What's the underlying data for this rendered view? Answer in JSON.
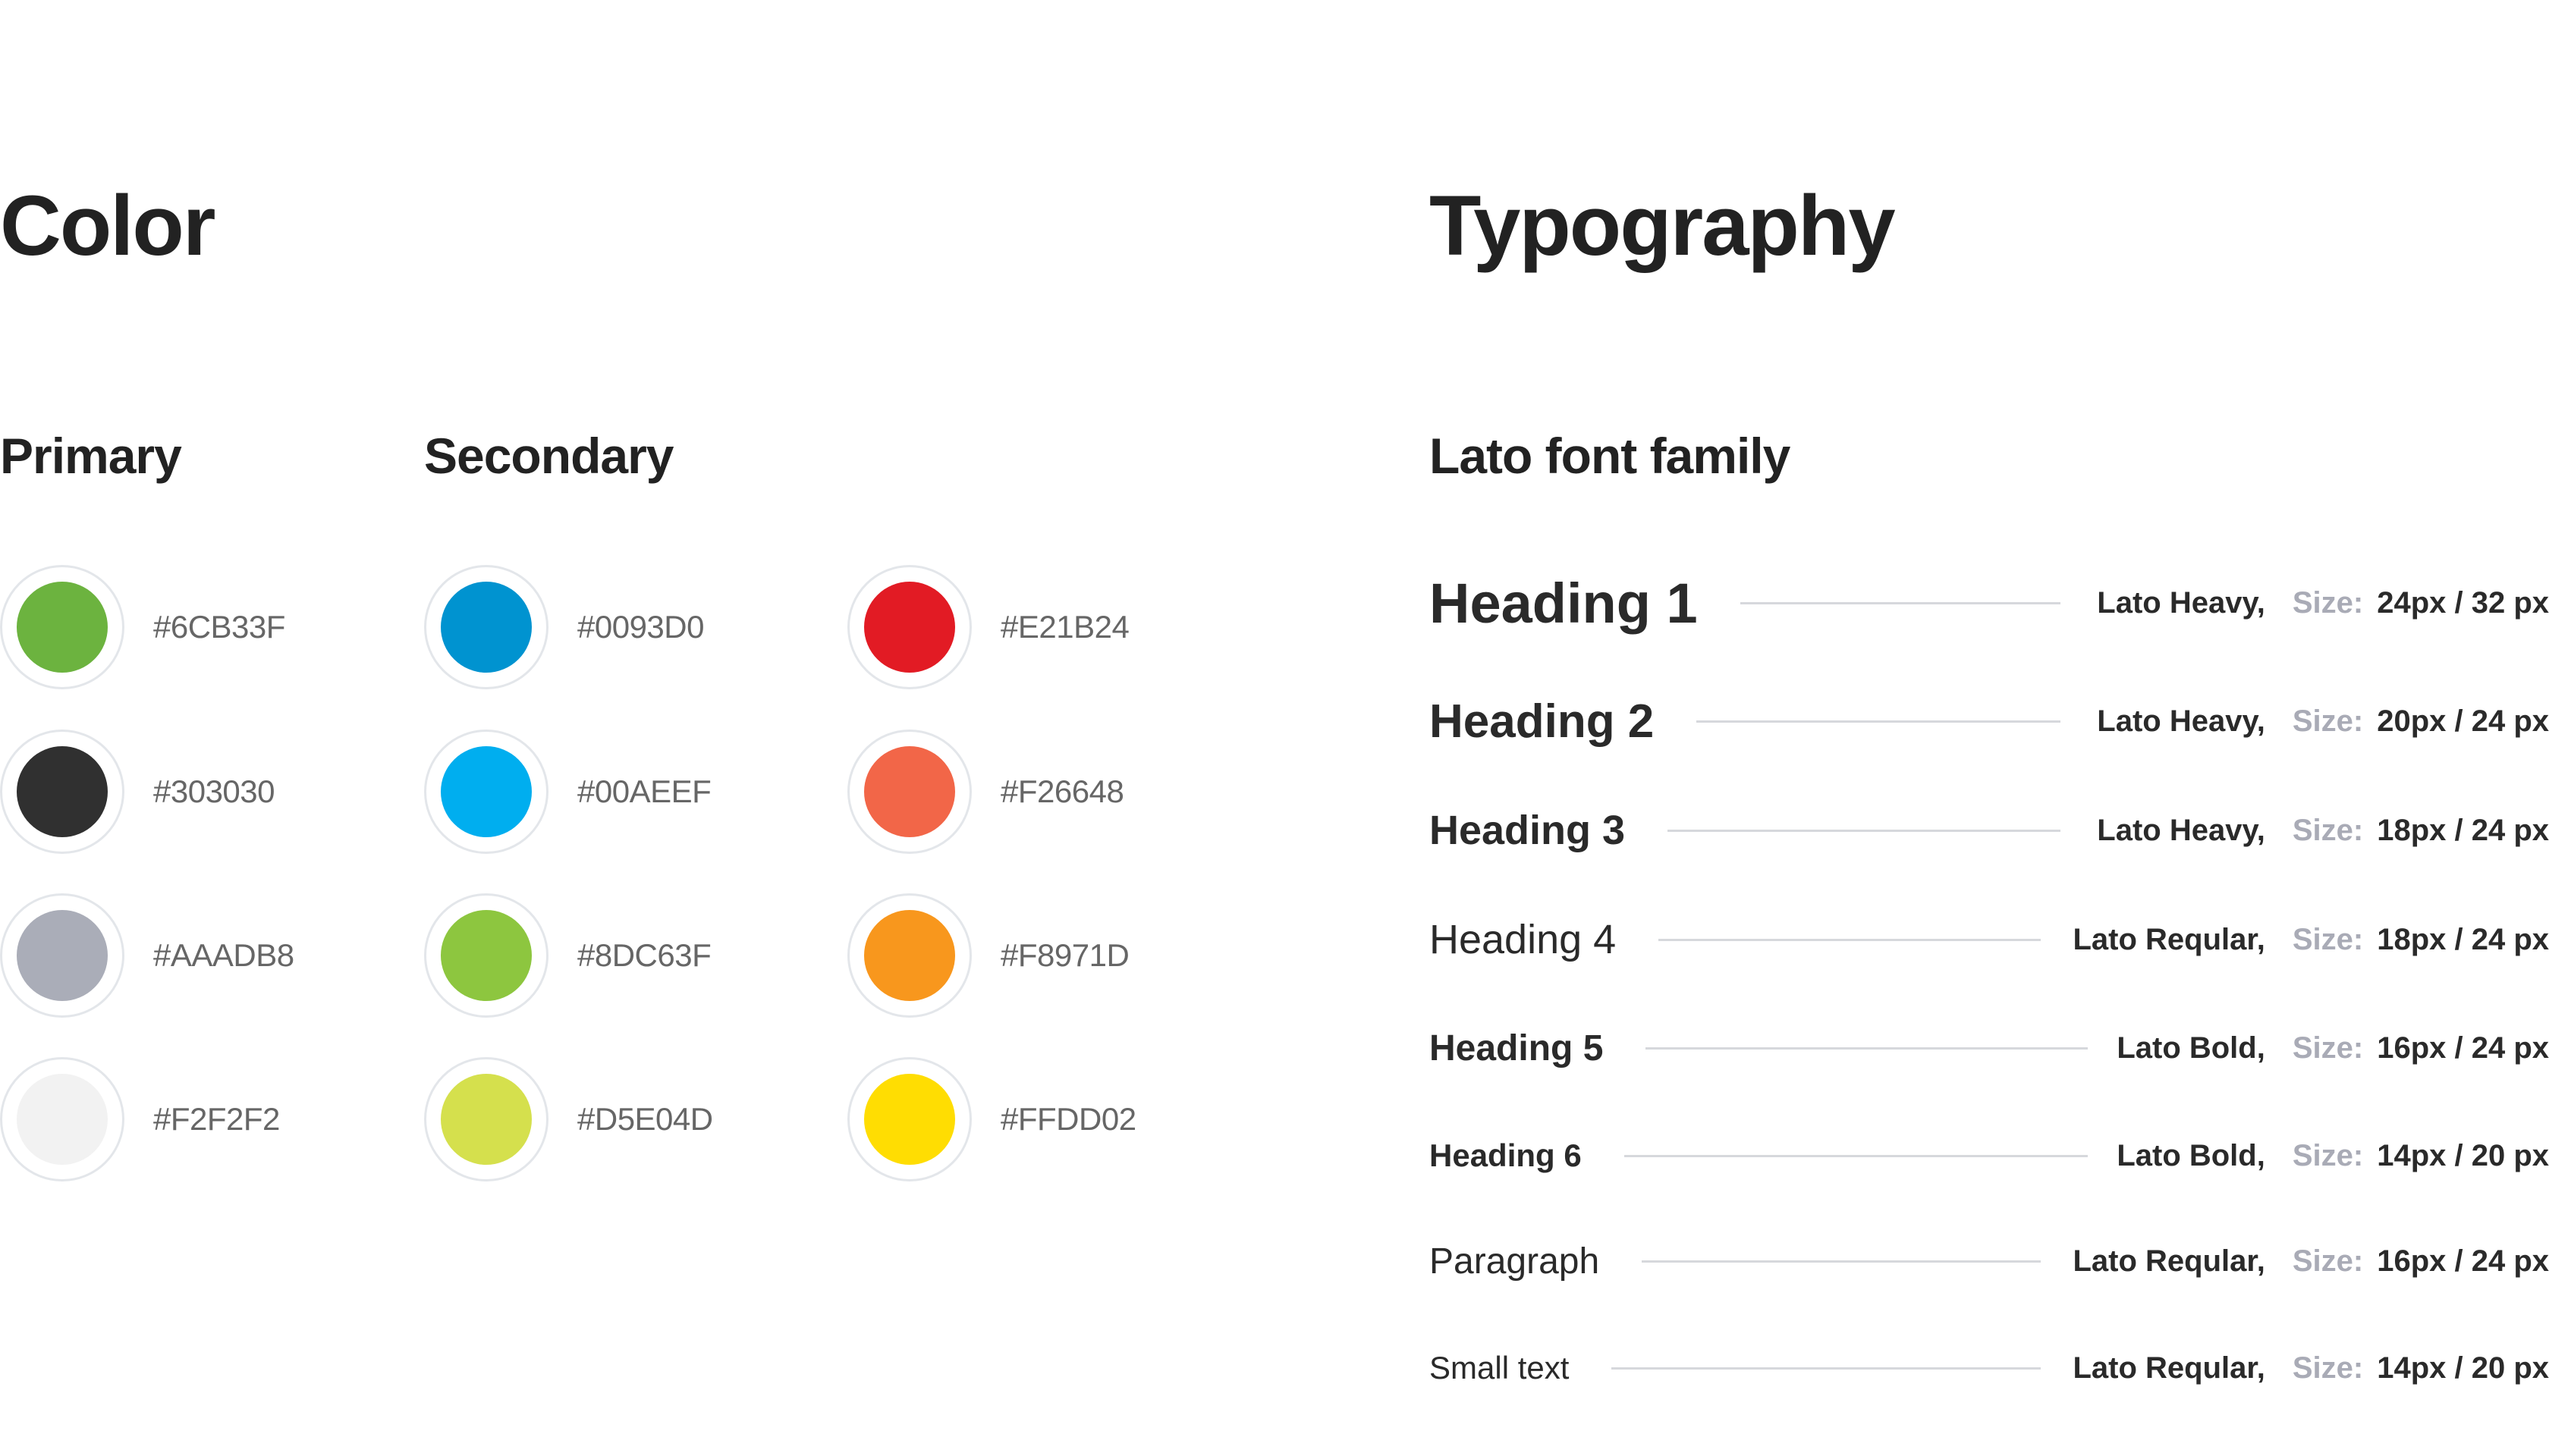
{
  "color_section": {
    "title": "Color",
    "primary": {
      "label": "Primary",
      "swatches": [
        {
          "hex": "#6CB33F"
        },
        {
          "hex": "#303030"
        },
        {
          "hex": "#AAADB8"
        },
        {
          "hex": "#F2F2F2"
        }
      ]
    },
    "secondary": {
      "label": "Secondary",
      "columns": [
        [
          {
            "hex": "#0093D0"
          },
          {
            "hex": "#00AEEF"
          },
          {
            "hex": "#8DC63F"
          },
          {
            "hex": "#D5E04D"
          }
        ],
        [
          {
            "hex": "#E21B24"
          },
          {
            "hex": "#F26648"
          },
          {
            "hex": "#F8971D"
          },
          {
            "hex": "#FFDD02"
          }
        ]
      ]
    }
  },
  "typography_section": {
    "title": "Typography",
    "font_family_label": "Lato font family",
    "size_label": "Size:",
    "rows": [
      {
        "sample": "Heading 1",
        "font": "Lato Heavy,",
        "size": "24px / 32 px",
        "weight": "heavy"
      },
      {
        "sample": "Heading 2",
        "font": "Lato Heavy,",
        "size": "20px / 24 px",
        "weight": "heavy"
      },
      {
        "sample": "Heading 3",
        "font": "Lato Heavy,",
        "size": "18px / 24 px",
        "weight": "heavy"
      },
      {
        "sample": "Heading 4",
        "font": "Lato Reqular,",
        "size": "18px / 24 px",
        "weight": "regular"
      },
      {
        "sample": "Heading 5",
        "font": "Lato Bold,",
        "size": "16px / 24 px",
        "weight": "bold"
      },
      {
        "sample": "Heading 6",
        "font": "Lato Bold,",
        "size": "14px / 20 px",
        "weight": "bold"
      },
      {
        "sample": "Paragraph",
        "font": "Lato Reqular,",
        "size": "16px / 24 px",
        "weight": "regular"
      },
      {
        "sample": "Small text",
        "font": "Lato Reqular,",
        "size": "14px / 20 px",
        "weight": "regular"
      }
    ]
  }
}
